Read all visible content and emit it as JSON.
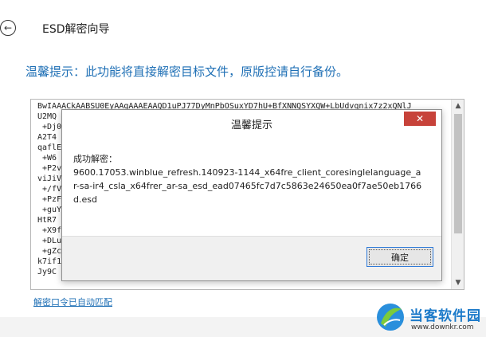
{
  "app": {
    "title": "ESD解密向导",
    "back_icon": "arrow-left-icon"
  },
  "main": {
    "tip": "温馨提示：此功能将直接解密目标文件，原版控请自行备份。",
    "key_lines": [
      "BwIAAACkAABSU0EyAAgAAAEAAQD1uPJ77DyMnPbOSuxYD7hU+BfXNNQSYXQW+LbUdvqnix7z2xQNlJ",
      "U2MQ",
      " +Dj0",
      "A2T4",
      "qaflE",
      " +W6",
      " +P2v",
      "viJiVs",
      " +/fV",
      " +PzF",
      " +guY",
      "HtR7",
      " +X9f",
      " +DLu",
      " +gZc",
      "k7if1",
      "Jy9C"
    ],
    "auto_match_link": "解密口令已自动匹配"
  },
  "dialog": {
    "title": "温馨提示",
    "close_icon": "close-icon",
    "message_label": "成功解密：",
    "message_file": "9600.17053.winblue_refresh.140923-1144_x64fre_client_coresinglelanguage_ar-sa-ir4_csla_x64frer_ar-sa_esd_ead07465fc7d7c5863e24650ea0f7ae50eb1766d.esd",
    "ok_label": "确定"
  },
  "watermark": {
    "title": "当客软件园",
    "url": "www.downkr.com"
  },
  "colors": {
    "accent": "#1e6fb5",
    "close": "#c7423a",
    "button_border": "#2f7ad8"
  }
}
